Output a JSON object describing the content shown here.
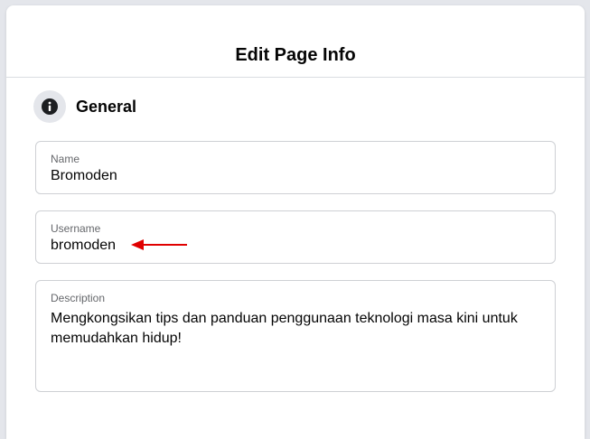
{
  "dialog": {
    "title": "Edit Page Info"
  },
  "section": {
    "title": "General",
    "icon": "info-icon"
  },
  "fields": {
    "name": {
      "label": "Name",
      "value": "Bromoden"
    },
    "username": {
      "label": "Username",
      "value": "bromoden"
    },
    "description": {
      "label": "Description",
      "value": "Mengkongsikan tips dan panduan penggunaan teknologi masa kini untuk memudahkan hidup!"
    }
  },
  "annotation": {
    "icon": "red-arrow-icon",
    "color": "#e00000"
  },
  "colors": {
    "background": "#e4e6eb",
    "border": "#ced0d4",
    "label": "#65676b"
  }
}
